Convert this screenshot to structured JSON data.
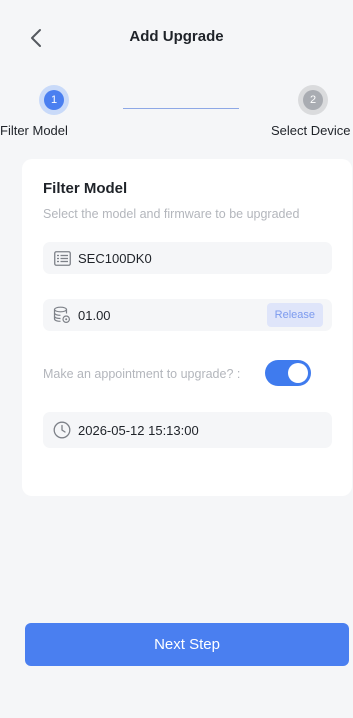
{
  "header": {
    "title": "Add Upgrade",
    "back_icon": "chevron-left-icon"
  },
  "steps": [
    {
      "number": "1",
      "label": "Filter Model",
      "active": true
    },
    {
      "number": "2",
      "label": "Select Device",
      "active": false
    }
  ],
  "card": {
    "title": "Filter Model",
    "subtitle": "Select the model and firmware to be upgraded",
    "model": {
      "value": "SEC100DK0",
      "icon": "list-icon"
    },
    "firmware": {
      "value": "01.00",
      "icon": "database-gear-icon",
      "tag": "Release"
    },
    "appointment": {
      "label": "Make an appointment to upgrade? :",
      "enabled": true
    },
    "schedule": {
      "value": "2026-05-12 15:13:00",
      "icon": "clock-icon"
    }
  },
  "footer": {
    "next_label": "Next Step"
  },
  "colors": {
    "accent": "#4a7ff0",
    "toggle": "#3f7bee",
    "inactive_step": "#a9acb2",
    "background": "#f5f6f8"
  }
}
